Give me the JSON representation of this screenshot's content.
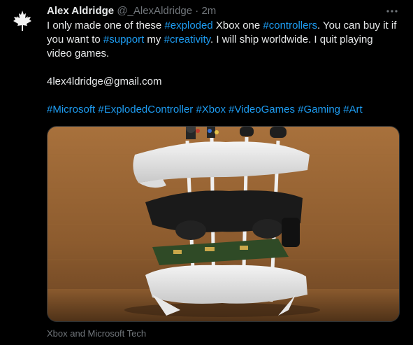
{
  "author": {
    "name": "Alex Aldridge",
    "handle": "@_AlexAldridge",
    "separator": "·",
    "time": "2m"
  },
  "icons": {
    "avatar": "maple-leaf-icon",
    "more": "more-options-icon"
  },
  "tweet": {
    "line1": {
      "t1": "I only made one of these ",
      "h1": "#exploded",
      "t2": " Xbox one ",
      "h2": "#controllers",
      "t3": ". You can buy it if you want to ",
      "h3": "#support",
      "t4": " my ",
      "h4": "#creativity",
      "t5": ". I will ship worldwide. I quit playing video games."
    },
    "email": "4lex4ldridge@gmail.com",
    "hashtags": [
      "#Microsoft",
      "#ExplodedController",
      "#Xbox",
      "#VideoGames",
      "#Gaming",
      "#Art"
    ]
  },
  "media": {
    "caption": "Xbox and Microsoft Tech"
  },
  "colors": {
    "background": "#000000",
    "text": "#e7e9ea",
    "muted": "#71767b",
    "link": "#1d9bf0"
  }
}
